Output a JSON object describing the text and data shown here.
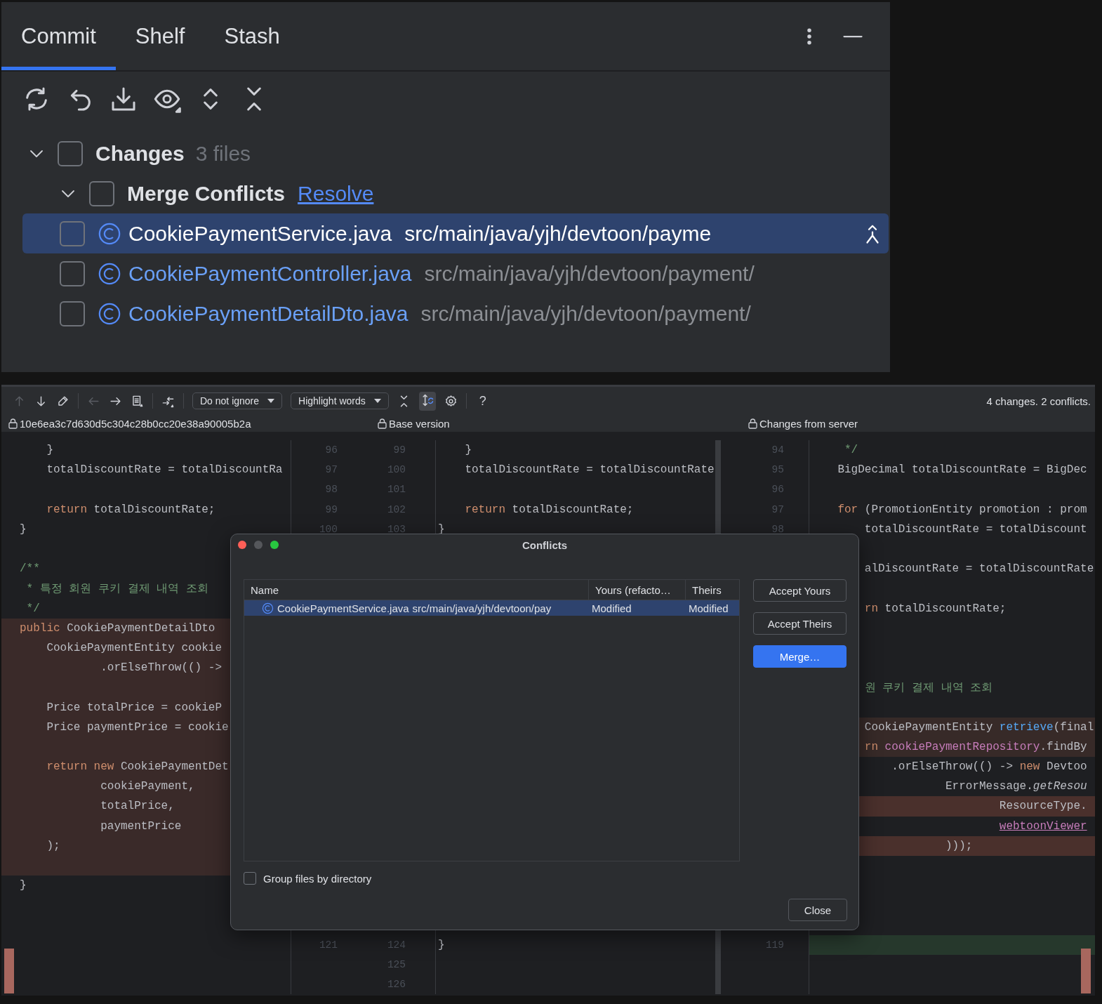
{
  "commit_panel": {
    "tabs": [
      {
        "label": "Commit",
        "selected": true
      },
      {
        "label": "Shelf",
        "selected": false
      },
      {
        "label": "Stash",
        "selected": false
      }
    ],
    "tree": [
      {
        "label": "Changes",
        "count": "3 files",
        "expanded": true,
        "checked": false,
        "children": [
          {
            "label": "Merge Conflicts",
            "link": "Resolve",
            "expanded": true,
            "checked": false,
            "children": [
              {
                "name": "CookiePaymentService.java",
                "path": "src/main/java/yjh/devtoon/payme",
                "checked": false,
                "selected": true
              },
              {
                "name": "CookiePaymentController.java",
                "path": "src/main/java/yjh/devtoon/payment/",
                "checked": false,
                "selected": false
              },
              {
                "name": "CookiePaymentDetailDto.java",
                "path": "src/main/java/yjh/devtoon/payment/",
                "checked": false,
                "selected": false
              }
            ]
          }
        ]
      }
    ]
  },
  "merge_view": {
    "tools": [
      {
        "kind": "arrow-up",
        "disabled": true
      },
      {
        "kind": "arrow-down",
        "disabled": false
      },
      {
        "kind": "edit",
        "disabled": false
      },
      {
        "kind": "separator"
      },
      {
        "kind": "arrow-left",
        "disabled": true
      },
      {
        "kind": "arrow-right",
        "disabled": false
      },
      {
        "kind": "document",
        "disabled": false
      },
      {
        "kind": "separator"
      },
      {
        "kind": "apply",
        "disabled": false
      },
      {
        "kind": "separator"
      },
      {
        "kind": "dropdown",
        "label": "Do not ignore"
      },
      {
        "kind": "dropdown",
        "label": "Highlight words"
      },
      {
        "kind": "collapse",
        "disabled": false
      },
      {
        "kind": "sync-scroll",
        "on": true
      },
      {
        "kind": "settings",
        "disabled": false
      },
      {
        "kind": "separator"
      },
      {
        "kind": "help",
        "label": "?"
      }
    ],
    "summary": "4 changes. 2 conflicts.",
    "pane_titles": [
      "10e6ea3c7d630d5c304c28b0cc20e38a90005b2a",
      "Base version",
      "Changes from server"
    ],
    "rows": [
      {
        "left": [
          {
            "text": "    }"
          }
        ],
        "left_no": "96",
        "base_no": "99",
        "base": [
          {
            "text": "    }"
          }
        ],
        "right_no": "94",
        "right": [
          {
            "text": "     */",
            "kind": "comment"
          }
        ]
      },
      {
        "left": [
          {
            "text": "    totalDiscountRate = totalDiscountRa"
          }
        ],
        "left_no": "97",
        "base_no": "100",
        "base": [
          {
            "text": "    totalDiscountRate = totalDiscountRate"
          }
        ],
        "right_no": "95",
        "right": [
          {
            "text": "    BigDecimal totalDiscountRate = BigDec"
          }
        ]
      },
      {
        "left_no": "98",
        "base_no": "101",
        "right_no": "96"
      },
      {
        "left": [
          {
            "text": "    return",
            "kind": "keyword"
          },
          {
            "text": " totalDiscountRate;"
          }
        ],
        "left_no": "99",
        "base_no": "102",
        "base": [
          {
            "text": "    return",
            "kind": "keyword"
          },
          {
            "text": " totalDiscountRate;"
          }
        ],
        "right_no": "97",
        "right": [
          {
            "text": "    for",
            "kind": "keyword"
          },
          {
            "text": " (PromotionEntity promotion : prom"
          }
        ]
      },
      {
        "left": [
          {
            "text": "}"
          }
        ],
        "left_no": "100",
        "base_no": "103",
        "base": [
          {
            "text": "}"
          }
        ],
        "right_no": "98",
        "right": [
          {
            "text": "        totalDiscountRate = totalDiscount"
          }
        ]
      },
      {},
      {
        "left": [
          {
            "text": "/**",
            "kind": "comment"
          }
        ],
        "right": [
          {
            "text": "        alDiscountRate = totalDiscountRate"
          }
        ]
      },
      {
        "left": [
          {
            "text": " * 특정 회원 쿠키 결제 내역 조회",
            "kind": "comment"
          }
        ]
      },
      {
        "left": [
          {
            "text": " */",
            "kind": "comment"
          }
        ],
        "right": [
          {
            "text": "        rn",
            "kind": "keyword"
          },
          {
            "text": " totalDiscountRate;"
          }
        ]
      },
      {
        "left": [
          {
            "text": "public",
            "kind": "keyword"
          },
          {
            "text": " CookiePaymentDetailDto"
          }
        ],
        "left_conflict": true
      },
      {
        "left": [
          {
            "text": "    CookiePaymentEntity cookie"
          }
        ],
        "left_conflict": true
      },
      {
        "left": [
          {
            "text": "            .orElseThrow(() ->"
          }
        ],
        "left_conflict": true
      },
      {
        "left_conflict": true,
        "right": [
          {
            "text": "        원 쿠키 결제 내역 조회",
            "kind": "comment"
          }
        ]
      },
      {
        "left": [
          {
            "text": "    Price totalPrice = cookieP"
          }
        ],
        "left_conflict": true
      },
      {
        "left": [
          {
            "text": "    Price paymentPrice = cookie"
          }
        ],
        "left_conflict": true,
        "right": [
          {
            "text": "        CookiePaymentEntity "
          },
          {
            "text": "retrieve",
            "kind": "method"
          },
          {
            "text": "(final"
          }
        ],
        "right_modified": true
      },
      {
        "left_conflict": true,
        "right": [
          {
            "text": "        rn",
            "kind": "keyword"
          },
          {
            "text": " cookiePaymentRepository",
            "kind": "field"
          },
          {
            "text": ".findBy"
          }
        ],
        "right_modified": true
      },
      {
        "left": [
          {
            "text": "    return",
            "kind": "keyword"
          },
          {
            "text": " new",
            "kind": "keyword"
          },
          {
            "text": " CookiePaymentDet"
          }
        ],
        "left_conflict": true,
        "right": [
          {
            "text": "            .orElseThrow(() -> "
          },
          {
            "text": "new",
            "kind": "keyword"
          },
          {
            "text": " Devtoo"
          }
        ]
      },
      {
        "left": [
          {
            "text": "            cookiePayment,"
          }
        ],
        "left_conflict": true,
        "right": [
          {
            "text": "                    ErrorMessage."
          },
          {
            "text": "getResou",
            "kind": "italic"
          }
        ]
      },
      {
        "left": [
          {
            "text": "            totalPrice,"
          }
        ],
        "left_conflict": true,
        "right": [
          {
            "text": "                            ResourceType."
          }
        ],
        "right_conflict": true
      },
      {
        "left": [
          {
            "text": "            paymentPrice"
          }
        ],
        "left_conflict": true,
        "right": [
          {
            "text": "                            webtoonViewer",
            "kind": "link"
          }
        ]
      },
      {
        "left": [
          {
            "text": "    );"
          }
        ],
        "left_conflict": true,
        "right": [
          {
            "text": "                    )));"
          }
        ],
        "right_conflict": true
      },
      {
        "left_conflict": true
      },
      {
        "left": [
          {
            "text": "}"
          }
        ]
      },
      {},
      {},
      {
        "left_no": "121",
        "base_no": "124",
        "base": [
          {
            "text": "}"
          }
        ],
        "right_no": "119",
        "right_added": true
      },
      {
        "base_no": "125"
      },
      {
        "base_no": "126"
      }
    ]
  },
  "conflicts_dialog": {
    "title": "Conflicts",
    "columns": [
      "Name",
      "Yours (refacto…",
      "Theirs"
    ],
    "rows": [
      {
        "name": "CookiePaymentService.java",
        "path": "src/main/java/yjh/devtoon/pay",
        "yours": "Modified",
        "theirs": "Modified",
        "selected": true
      }
    ],
    "buttons": [
      {
        "label": "Accept Yours",
        "kind": "secondary"
      },
      {
        "label": "Accept Theirs",
        "kind": "secondary"
      },
      {
        "label": "Merge…",
        "kind": "primary"
      }
    ],
    "group_option": {
      "label": "Group files by directory",
      "checked": false
    },
    "close_label": "Close"
  }
}
